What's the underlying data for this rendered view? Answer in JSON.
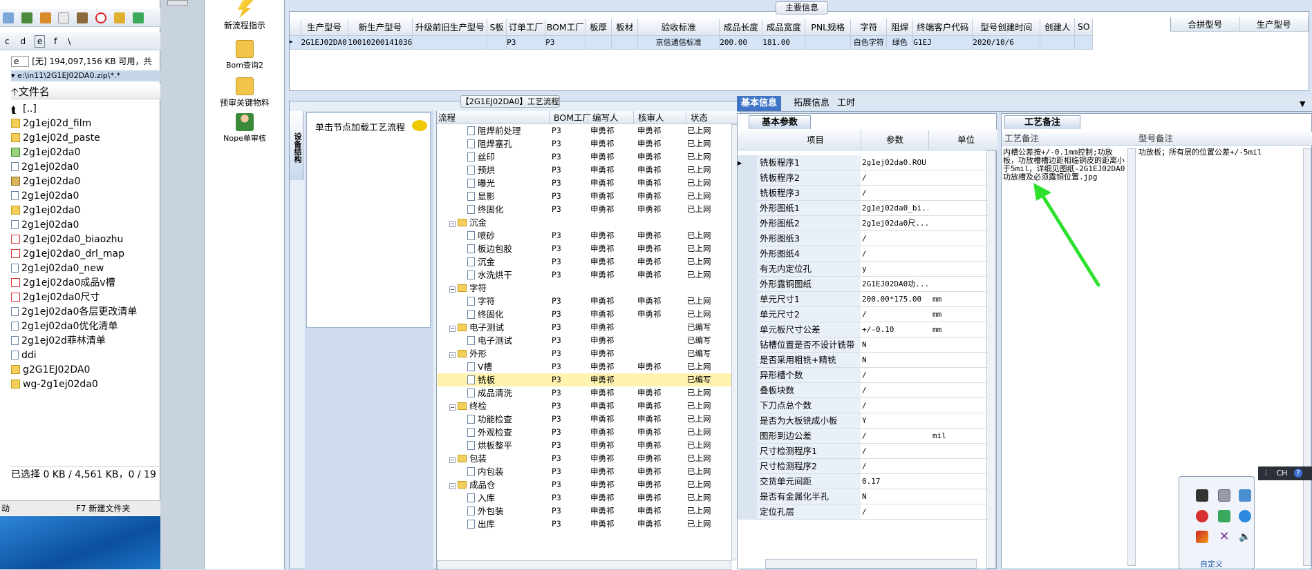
{
  "file_manager": {
    "drives": [
      "c",
      "d",
      "e",
      "f",
      "\\"
    ],
    "selected_drive": "e",
    "free_space": "[无] 194,097,156 KB 可用，共",
    "path": "e:\\in11\\2G1EJ02DA0.zip\\*.*",
    "column_header": "文件名",
    "items": [
      {
        "name": "[..]",
        "type": "up"
      },
      {
        "name": "2g1ej02d_film",
        "type": "folder"
      },
      {
        "name": "2g1ej02d_paste",
        "type": "folder"
      },
      {
        "name": "2g1ej02da0",
        "type": "img"
      },
      {
        "name": "2g1ej02da0",
        "type": "doc"
      },
      {
        "name": "2g1ej02da0",
        "type": "zip"
      },
      {
        "name": "2g1ej02da0",
        "type": "doc"
      },
      {
        "name": "2g1ej02da0",
        "type": "folder"
      },
      {
        "name": "2g1ej02da0",
        "type": "doc"
      },
      {
        "name": "2g1ej02da0_biaozhu",
        "type": "pdf"
      },
      {
        "name": "2g1ej02da0_drl_map",
        "type": "pdf"
      },
      {
        "name": "2g1ej02da0_new",
        "type": "doc"
      },
      {
        "name": "2g1ej02da0成品v槽",
        "type": "pdf"
      },
      {
        "name": "2g1ej02da0尺寸",
        "type": "pdf"
      },
      {
        "name": "2g1ej02da0各层更改清单",
        "type": "doc"
      },
      {
        "name": "2g1ej02da0优化清单",
        "type": "doc"
      },
      {
        "name": "2g1ej02d菲林清单",
        "type": "doc"
      },
      {
        "name": "ddi",
        "type": "doc"
      },
      {
        "name": "g2G1EJ02DA0",
        "type": "folder"
      },
      {
        "name": "wg-2g1ej02da0",
        "type": "folder"
      }
    ],
    "status": "已选择 0 KB / 4,561 KB，0 / 19",
    "footer_left": "动",
    "footer_f7": "F7 新建文件夹"
  },
  "nav": [
    {
      "label": "新流程指示",
      "icon": "lightning-icon"
    },
    {
      "label": "Bom查询2",
      "icon": "folder-icon"
    },
    {
      "label": "预审关键物料",
      "icon": "folder-icon"
    },
    {
      "label": "Nope单审核",
      "icon": "user-icon"
    }
  ],
  "main_info": {
    "title": "主要信息",
    "columns": [
      "生产型号",
      "新生产型号",
      "升级前旧生产型号",
      "S板",
      "订单工厂",
      "BOM工厂",
      "板厚",
      "板材",
      "验收标准",
      "成品长度",
      "成品宽度",
      "PNL规格",
      "字符",
      "阻焊",
      "终端客户代码",
      "型号创建时间",
      "创建人",
      "SO"
    ],
    "row": [
      "2G1EJ02DA0",
      "10010200141036",
      "",
      "",
      "P3",
      "P3",
      "",
      "",
      "京信通信标准",
      "200.00",
      "181.00",
      "",
      "白色字符",
      "绿色",
      "G1EJ",
      "2020/10/6",
      "",
      ""
    ],
    "side_columns": [
      "合拼型号",
      "生产型号"
    ]
  },
  "flow": {
    "title": "【2G1EJ02DA0】工艺流程",
    "side_tab": "设备结构",
    "hint": "单击节点加载工艺流程",
    "columns": [
      "流程",
      "BOM工厂",
      "编写人",
      "核审人",
      "状态"
    ],
    "rows": [
      {
        "name": "阻焊前处理",
        "lvl": 2,
        "bom": "P3",
        "w": "申勇祁",
        "r": "申勇祁",
        "s": "已上网"
      },
      {
        "name": "阻焊塞孔",
        "lvl": 2,
        "bom": "P3",
        "w": "申勇祁",
        "r": "申勇祁",
        "s": "已上网"
      },
      {
        "name": "丝印",
        "lvl": 2,
        "bom": "P3",
        "w": "申勇祁",
        "r": "申勇祁",
        "s": "已上网"
      },
      {
        "name": "预烘",
        "lvl": 2,
        "bom": "P3",
        "w": "申勇祁",
        "r": "申勇祁",
        "s": "已上网"
      },
      {
        "name": "曝光",
        "lvl": 2,
        "bom": "P3",
        "w": "申勇祁",
        "r": "申勇祁",
        "s": "已上网"
      },
      {
        "name": "显影",
        "lvl": 2,
        "bom": "P3",
        "w": "申勇祁",
        "r": "申勇祁",
        "s": "已上网"
      },
      {
        "name": "终固化",
        "lvl": 2,
        "bom": "P3",
        "w": "申勇祁",
        "r": "申勇祁",
        "s": "已上网"
      },
      {
        "name": "沉金",
        "lvl": 1,
        "bom": "",
        "w": "",
        "r": "",
        "s": ""
      },
      {
        "name": "喷砂",
        "lvl": 2,
        "bom": "P3",
        "w": "申勇祁",
        "r": "申勇祁",
        "s": "已上网"
      },
      {
        "name": "板边包胶",
        "lvl": 2,
        "bom": "P3",
        "w": "申勇祁",
        "r": "申勇祁",
        "s": "已上网"
      },
      {
        "name": "沉金",
        "lvl": 2,
        "bom": "P3",
        "w": "申勇祁",
        "r": "申勇祁",
        "s": "已上网"
      },
      {
        "name": "水洗烘干",
        "lvl": 2,
        "bom": "P3",
        "w": "申勇祁",
        "r": "申勇祁",
        "s": "已上网"
      },
      {
        "name": "字符",
        "lvl": 1,
        "bom": "",
        "w": "",
        "r": "",
        "s": ""
      },
      {
        "name": "字符",
        "lvl": 2,
        "bom": "P3",
        "w": "申勇祁",
        "r": "申勇祁",
        "s": "已上网"
      },
      {
        "name": "终固化",
        "lvl": 2,
        "bom": "P3",
        "w": "申勇祁",
        "r": "申勇祁",
        "s": "已上网"
      },
      {
        "name": "电子测试",
        "lvl": 1,
        "bom": "P3",
        "w": "申勇祁",
        "r": "",
        "s": "已编写"
      },
      {
        "name": "电子测试",
        "lvl": 2,
        "bom": "P3",
        "w": "申勇祁",
        "r": "",
        "s": "已编写"
      },
      {
        "name": "外形",
        "lvl": 1,
        "bom": "P3",
        "w": "申勇祁",
        "r": "",
        "s": "已编写"
      },
      {
        "name": "V槽",
        "lvl": 2,
        "bom": "P3",
        "w": "申勇祁",
        "r": "申勇祁",
        "s": "已上网"
      },
      {
        "name": "铣板",
        "lvl": 2,
        "bom": "P3",
        "w": "申勇祁",
        "r": "",
        "s": "已编写",
        "sel": true
      },
      {
        "name": "成品清洗",
        "lvl": 2,
        "bom": "P3",
        "w": "申勇祁",
        "r": "申勇祁",
        "s": "已上网"
      },
      {
        "name": "终检",
        "lvl": 1,
        "bom": "P3",
        "w": "申勇祁",
        "r": "申勇祁",
        "s": "已上网"
      },
      {
        "name": "功能检查",
        "lvl": 2,
        "bom": "P3",
        "w": "申勇祁",
        "r": "申勇祁",
        "s": "已上网"
      },
      {
        "name": "外观检查",
        "lvl": 2,
        "bom": "P3",
        "w": "申勇祁",
        "r": "申勇祁",
        "s": "已上网"
      },
      {
        "name": "烘板整平",
        "lvl": 2,
        "bom": "P3",
        "w": "申勇祁",
        "r": "申勇祁",
        "s": "已上网"
      },
      {
        "name": "包装",
        "lvl": 1,
        "bom": "P3",
        "w": "申勇祁",
        "r": "申勇祁",
        "s": "已上网"
      },
      {
        "name": "内包装",
        "lvl": 2,
        "bom": "P3",
        "w": "申勇祁",
        "r": "申勇祁",
        "s": "已上网"
      },
      {
        "name": "成品仓",
        "lvl": 1,
        "bom": "P3",
        "w": "申勇祁",
        "r": "申勇祁",
        "s": "已上网"
      },
      {
        "name": "入库",
        "lvl": 2,
        "bom": "P3",
        "w": "申勇祁",
        "r": "申勇祁",
        "s": "已上网"
      },
      {
        "name": "外包装",
        "lvl": 2,
        "bom": "P3",
        "w": "申勇祁",
        "r": "申勇祁",
        "s": "已上网"
      },
      {
        "name": "出库",
        "lvl": 2,
        "bom": "P3",
        "w": "申勇祁",
        "r": "申勇祁",
        "s": "已上网"
      }
    ]
  },
  "tabs": [
    "基本信息",
    "拓展信息",
    "工时"
  ],
  "basic": {
    "title": "基本参数",
    "columns": [
      "项目",
      "参数",
      "单位"
    ],
    "rows": [
      [
        "铣板程序1",
        "2g1ej02da0.ROU",
        ""
      ],
      [
        "铣板程序2",
        "/",
        ""
      ],
      [
        "铣板程序3",
        "/",
        ""
      ],
      [
        "外形图纸1",
        "2g1ej02da0_bi...",
        ""
      ],
      [
        "外形图纸2",
        "2g1ej02da0尺...",
        ""
      ],
      [
        "外形图纸3",
        "/",
        ""
      ],
      [
        "外形图纸4",
        "/",
        ""
      ],
      [
        "有无内定位孔",
        "y",
        ""
      ],
      [
        "外形露铜图纸",
        "2G1EJ02DA0功...",
        ""
      ],
      [
        "单元尺寸1",
        "200.00*175.00",
        "mm"
      ],
      [
        "单元尺寸2",
        "/",
        "mm"
      ],
      [
        "单元板尺寸公差",
        "+/-0.10",
        "mm"
      ],
      [
        "钻槽位置是否不设计铣带",
        "N",
        ""
      ],
      [
        "是否采用粗铣+精铣",
        "N",
        ""
      ],
      [
        "异形槽个数",
        "/",
        ""
      ],
      [
        "叠板块数",
        "/",
        ""
      ],
      [
        "下刀点总个数",
        "/",
        ""
      ],
      [
        "是否为大板铣成小板",
        "Y",
        ""
      ],
      [
        "图形到边公差",
        "/",
        "mil"
      ],
      [
        "尺寸检测程序1",
        "/",
        ""
      ],
      [
        "尺寸检测程序2",
        "/",
        ""
      ],
      [
        "交货单元间距",
        "0.17",
        ""
      ],
      [
        "是否有金属化半孔",
        "N",
        ""
      ],
      [
        "定位孔层",
        "/",
        ""
      ]
    ]
  },
  "notes": {
    "tab": "工艺备注",
    "col1": "工艺备注",
    "col2": "型号备注",
    "text1": "内槽公差按+/-0.1mm控制;功放板，功放槽槽边距相临铜皮的距离小于5mil，详细见图纸-2G1EJ02DA0功放槽及必须露铜位置.jpg",
    "text2": "功放板；所有层的位置公差+/-5mil"
  },
  "tray": {
    "lang": "CH",
    "label": "自定义"
  }
}
